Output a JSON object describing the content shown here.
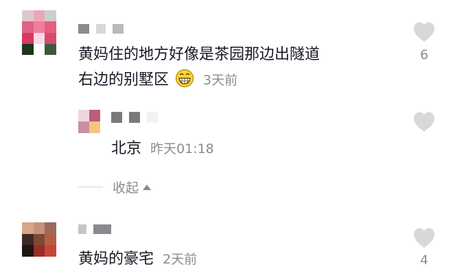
{
  "comments": [
    {
      "text_line1": "黄妈住的地方好像是茶园那边出隧道",
      "text_line2": "右边的别墅区",
      "time": "3天前",
      "likes": "6",
      "emoji": "grinning-face-emoji"
    },
    {
      "text": "北京",
      "time": "昨天01:18",
      "reply_level": 1
    },
    {
      "text": "黄妈的豪宅",
      "time": "2天前",
      "likes": "4"
    }
  ],
  "collapse": {
    "label": "收起",
    "icon": "triangle-up-icon"
  },
  "colors": {
    "text": "#161823",
    "meta": "#8a8b91",
    "heart": "#d8d8da",
    "divider": "#d5d5d8"
  },
  "icons": {
    "like": "heart-icon"
  }
}
